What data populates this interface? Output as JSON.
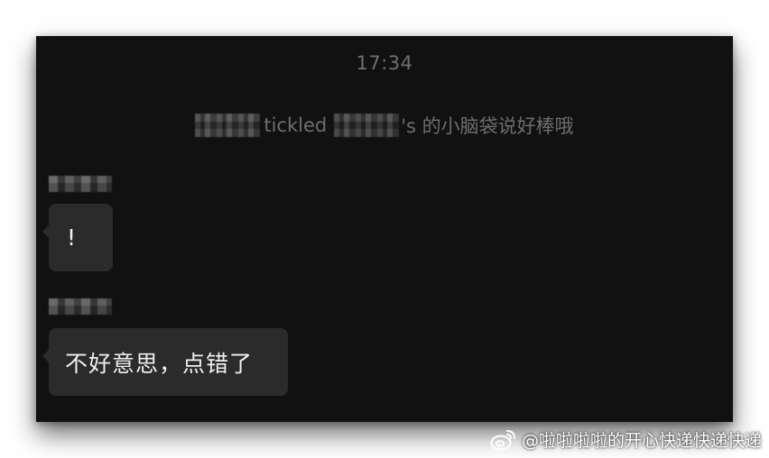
{
  "chat": {
    "timestamp": "17:34",
    "system_message": {
      "verb": "tickled",
      "suffix": "'s 的小脑袋说好棒哦"
    },
    "messages": [
      {
        "text": "!"
      },
      {
        "text": "不好意思，点错了"
      }
    ]
  },
  "watermark": {
    "icon": "weibo-icon",
    "text": "@啦啦啦啦的开心快递快递快递"
  },
  "colors": {
    "window_bg": "#111111",
    "bubble_bg": "#2b2b2b",
    "muted_text": "#6d6d6d",
    "message_text": "#f0f0f0"
  }
}
